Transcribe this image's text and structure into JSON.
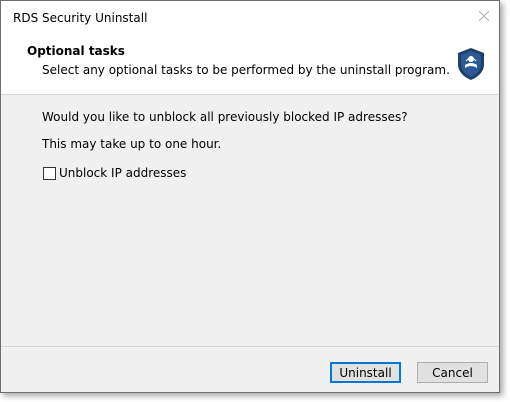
{
  "window": {
    "title": "RDS Security Uninstall"
  },
  "header": {
    "title": "Optional tasks",
    "subtitle": "Select any optional tasks to be performed by the uninstall program."
  },
  "content": {
    "question": "Would you like to unblock all previously blocked IP adresses?",
    "note": "This may take up to one hour.",
    "checkbox_label": "Unblock IP addresses",
    "checkbox_checked": false
  },
  "buttons": {
    "uninstall": "Uninstall",
    "cancel": "Cancel"
  },
  "colors": {
    "logo_fill": "#1f3f6b",
    "accent": "#0078d7"
  },
  "icons": {
    "close": "close-icon",
    "logo": "shield-logo-icon"
  }
}
